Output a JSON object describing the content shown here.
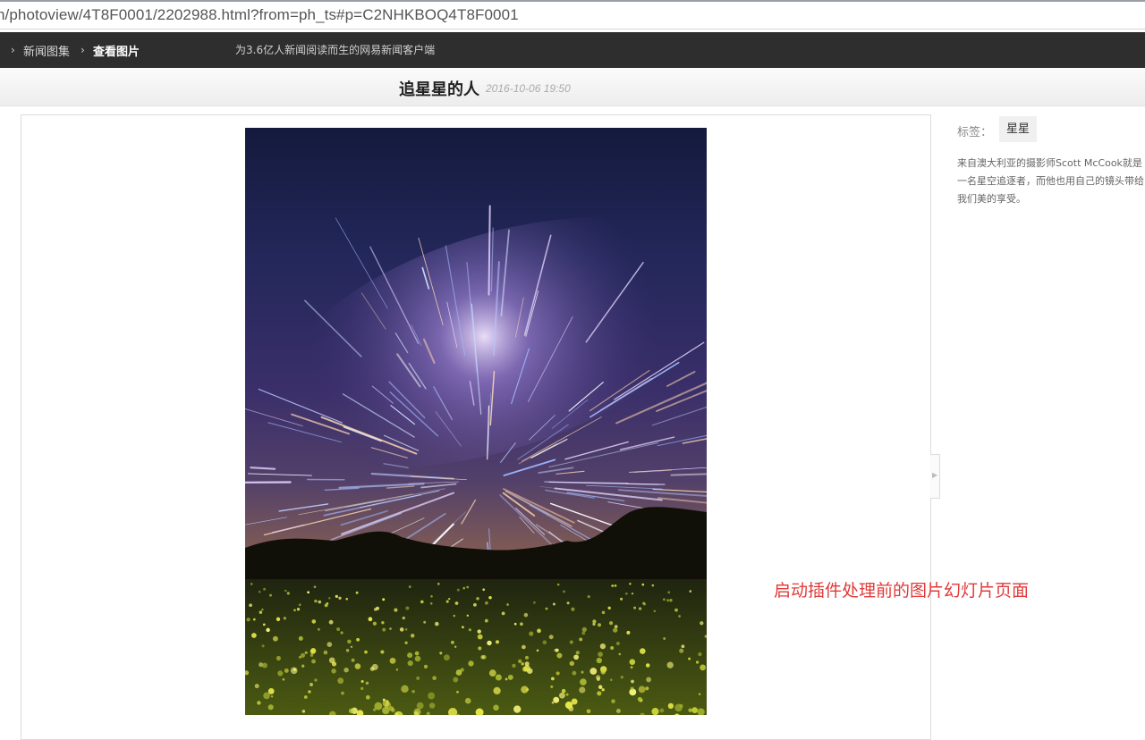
{
  "address_bar": {
    "url": "n/photoview/4T8F0001/2202988.html?from=ph_ts#p=C2NHKBOQ4T8F0001"
  },
  "nav": {
    "breadcrumbs": [
      {
        "label": "新闻图集"
      },
      {
        "label": "查看图片"
      }
    ],
    "slogan": "为3.6亿人新闻阅读而生的网易新闻客户端"
  },
  "album": {
    "title": "追星星的人",
    "date": "2016-10-06 19:50"
  },
  "sidebar": {
    "tags_label": "标签：",
    "tag": "星星",
    "description": "来自澳大利亚的摄影师Scott McCook就是一名星空追逐者，而他也用自己的镜头带给我们美的享受。"
  },
  "annotation": "启动插件处理前的图片幻灯片页面",
  "icons": {
    "breadcrumb_separator": "chevron-right-icon",
    "panel_toggle": "triangle-right-icon"
  },
  "colors": {
    "nav_bg": "#2e2e2e",
    "annotation": "#e03a3a"
  }
}
